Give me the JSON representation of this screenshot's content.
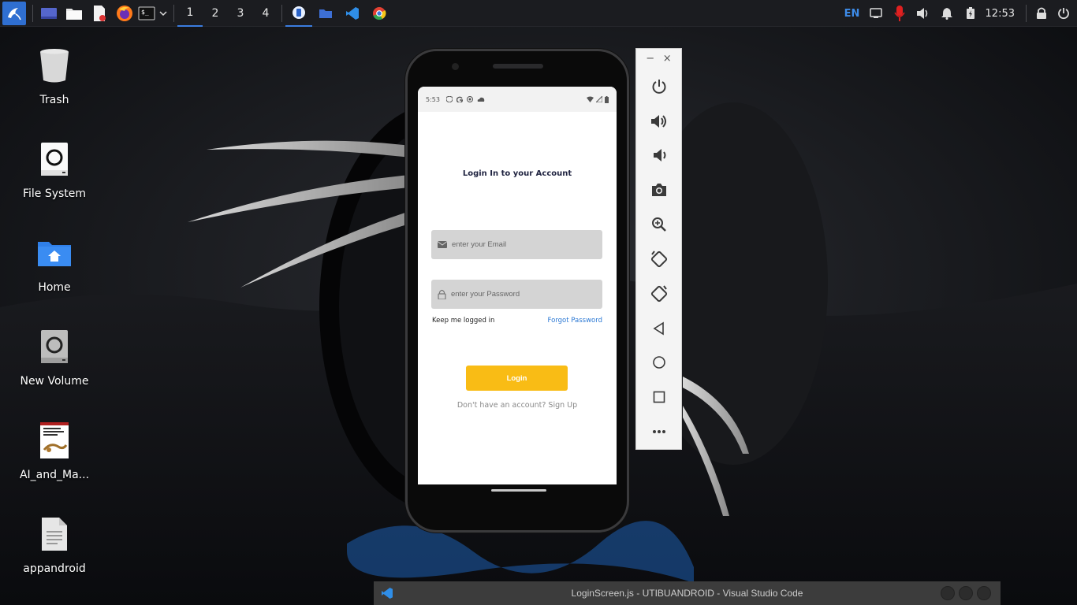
{
  "colors": {
    "panel_bg": "#1b1c20",
    "accent_blue": "#3b7de0",
    "login_button": "#f9bc15",
    "forgot_link": "#2b78d4",
    "field_bg": "#d4d4d4"
  },
  "top_panel": {
    "workspaces": [
      "1",
      "2",
      "3",
      "4"
    ],
    "active_workspace": "1",
    "tray": {
      "language": "EN",
      "clock": "12:53"
    }
  },
  "desktop": {
    "icons": [
      {
        "label": "Trash",
        "icon": "trash-icon"
      },
      {
        "label": "File System",
        "icon": "drive-icon"
      },
      {
        "label": "Home",
        "icon": "home-folder-icon"
      },
      {
        "label": "New Volume",
        "icon": "drive-icon"
      },
      {
        "label": "AI_and_Ma...",
        "icon": "book-thumbnail-icon"
      },
      {
        "label": "appandroid",
        "icon": "text-file-icon"
      }
    ]
  },
  "phone": {
    "status_bar": {
      "time": "5:53"
    },
    "login": {
      "title": "Login In to your Account",
      "email_placeholder": "enter your Email",
      "password_placeholder": "enter your Password",
      "keep_logged_in": "Keep me logged in",
      "forgot_password": "Forgot Password",
      "login_button": "Login",
      "signup_text": "Don't have an account? Sign Up"
    }
  },
  "emulator_toolbar": {
    "window_controls": [
      "−",
      "×"
    ],
    "buttons": [
      "power",
      "volume-up",
      "volume-down",
      "screenshot",
      "zoom",
      "rotate-left",
      "rotate-right",
      "back",
      "home",
      "overview",
      "more"
    ]
  },
  "vscode_window": {
    "title": "LoginScreen.js - UTIBUANDROID - Visual Studio Code"
  }
}
